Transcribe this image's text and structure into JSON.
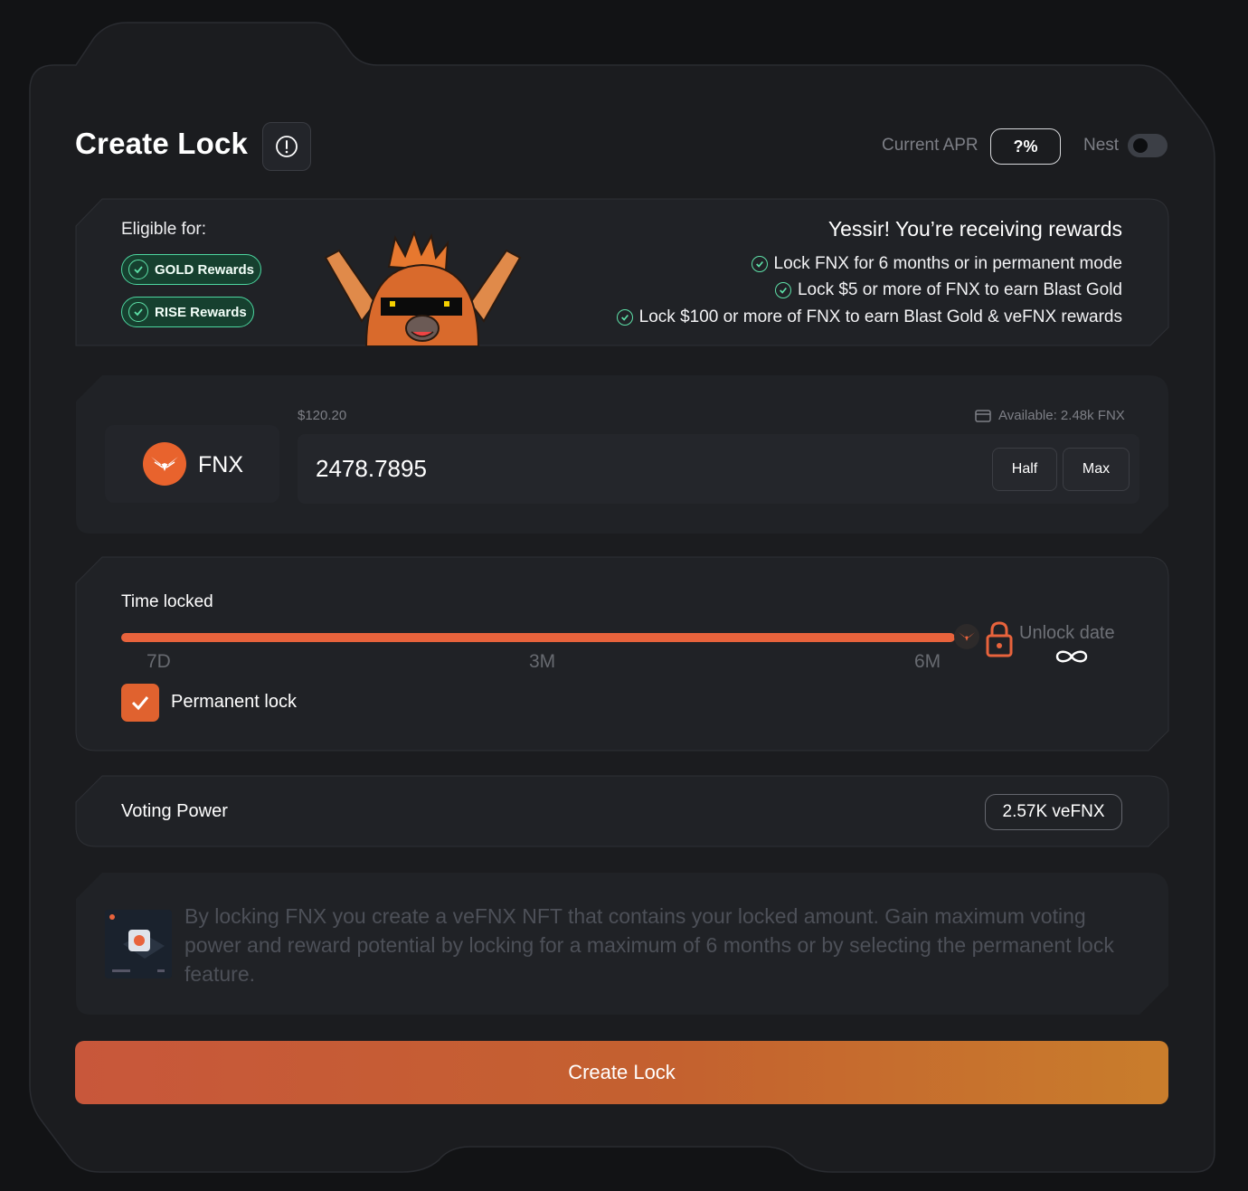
{
  "header": {
    "title": "Create Lock",
    "apr_label": "Current APR",
    "apr_value": "?%",
    "nest_label": "Nest",
    "nest_enabled": false
  },
  "rewards": {
    "eligible_label": "Eligible for:",
    "badges": [
      "GOLD Rewards",
      "RISE Rewards"
    ],
    "headline": "Yessir! You’re receiving rewards",
    "lines": [
      "Lock FNX for 6 months or in permanent mode",
      "Lock $5 or more of FNX to earn Blast Gold",
      "Lock $100 or more of FNX to earn Blast Gold & veFNX rewards"
    ]
  },
  "token": {
    "symbol": "FNX",
    "usd_value": "$120.20",
    "available": "Available: 2.48k FNX",
    "amount": "2478.7895",
    "half_label": "Half",
    "max_label": "Max"
  },
  "time": {
    "label": "Time locked",
    "ticks": [
      "7D",
      "3M",
      "6M"
    ],
    "slider_fraction": 1.0,
    "unlock_label": "Unlock date",
    "unlock_value": "∞",
    "permanent_label": "Permanent lock",
    "permanent_checked": true
  },
  "voting": {
    "label": "Voting Power",
    "value": "2.57K veFNX"
  },
  "description": "By locking FNX you create a veFNX NFT that contains your locked amount. Gain maximum voting power and reward potential by locking for a maximum of 6 months or by selecting the permanent lock feature.",
  "cta_label": "Create Lock",
  "colors": {
    "accent": "#e8633c",
    "success": "#4dd6a0",
    "panel": "#202226",
    "card": "#26282d"
  }
}
